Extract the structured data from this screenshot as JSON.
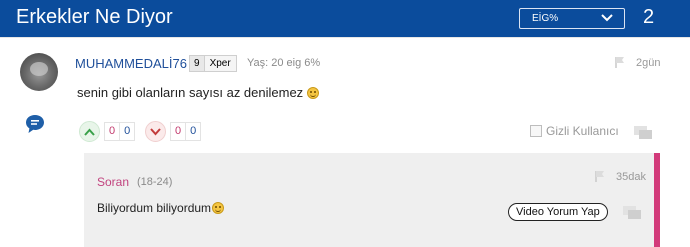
{
  "header": {
    "title": "Erkekler Ne Diyor",
    "sort_value": "EİG%",
    "count": "2"
  },
  "comment": {
    "username": "MUHAMMEDALİ76",
    "level": "9",
    "level_label": "Xper",
    "meta": "Yaş: 20 eig 6%",
    "time": "2gün",
    "text": "senin gibi olanların sayısı az denilemez",
    "upvote_counts": [
      "0",
      "0"
    ],
    "downvote_counts": [
      "0",
      "0"
    ],
    "anonymous_label": "Gizli Kullanıcı"
  },
  "reply": {
    "username": "Soran",
    "age": "(18-24)",
    "time": "35dak",
    "text": "Biliyordum biliyordum",
    "video_button_label": "Video Yorum Yap"
  },
  "colors": {
    "header_bg": "#0b4c9c",
    "reply_accent": "#d23a7a",
    "username": "#1f4f9a",
    "upvote": "#3aa14a",
    "downvote": "#c23a3a"
  }
}
